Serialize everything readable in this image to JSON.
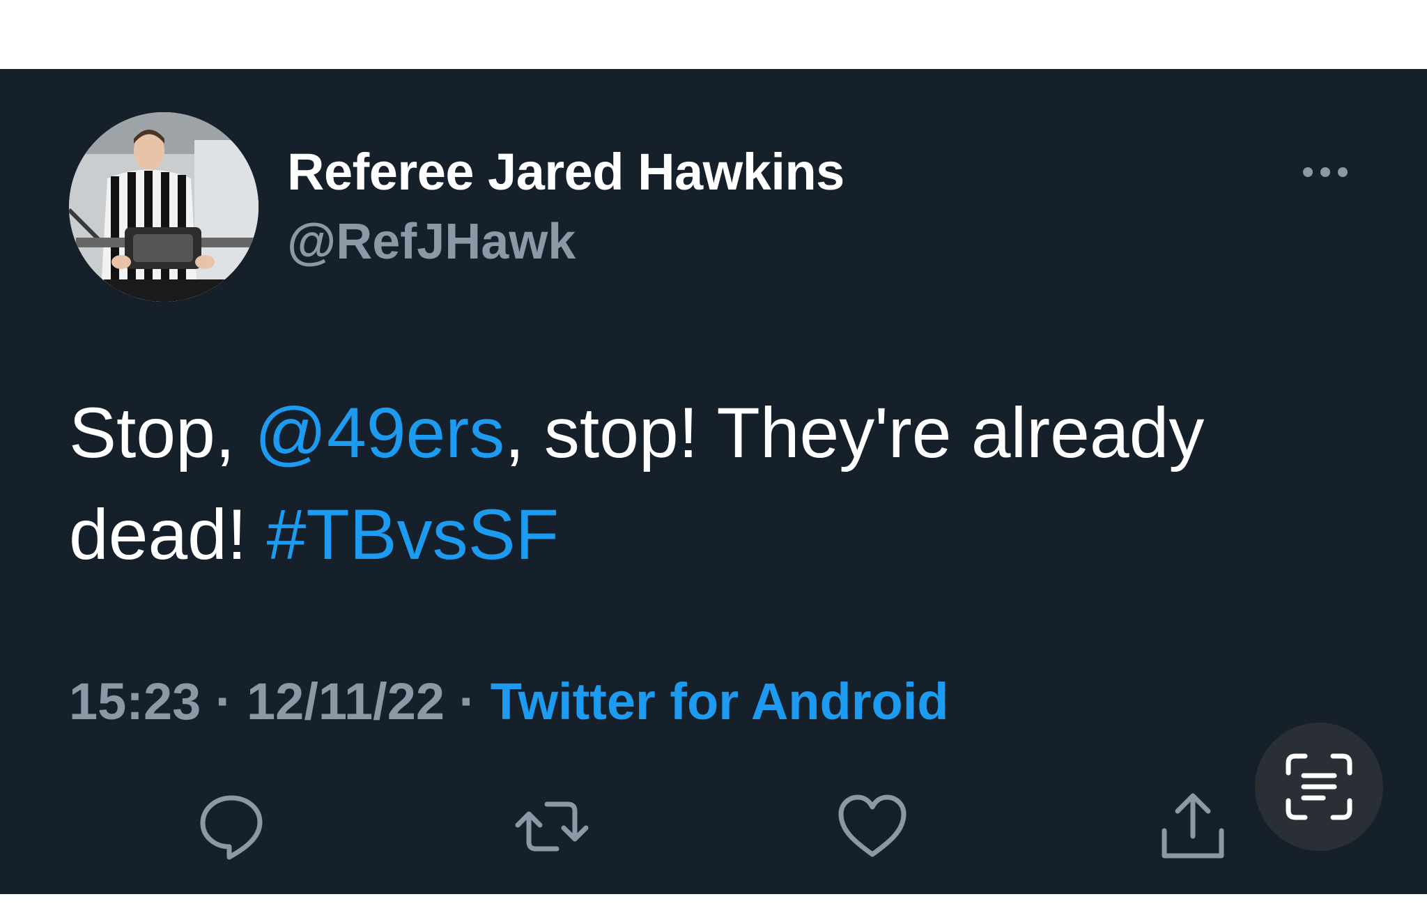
{
  "tweet": {
    "display_name": "Referee Jared Hawkins",
    "handle": "@RefJHawk",
    "text_parts": {
      "part1": "Stop, ",
      "mention": "@49ers",
      "part2": ", stop! They're already dead! ",
      "hashtag": "#TBvsSF"
    },
    "time": "15:23",
    "separator": " · ",
    "date": "12/11/22",
    "source": "Twitter for Android"
  },
  "icons": {
    "more": "more-horizontal-icon",
    "reply": "reply-icon",
    "retweet": "retweet-icon",
    "like": "heart-icon",
    "share": "share-icon",
    "scan": "live-text-scan-icon"
  },
  "colors": {
    "background": "#15202b",
    "text": "#ffffff",
    "secondary_text": "#8b98a5",
    "link": "#1d9bf0",
    "scan_button": "#2a2f36"
  }
}
